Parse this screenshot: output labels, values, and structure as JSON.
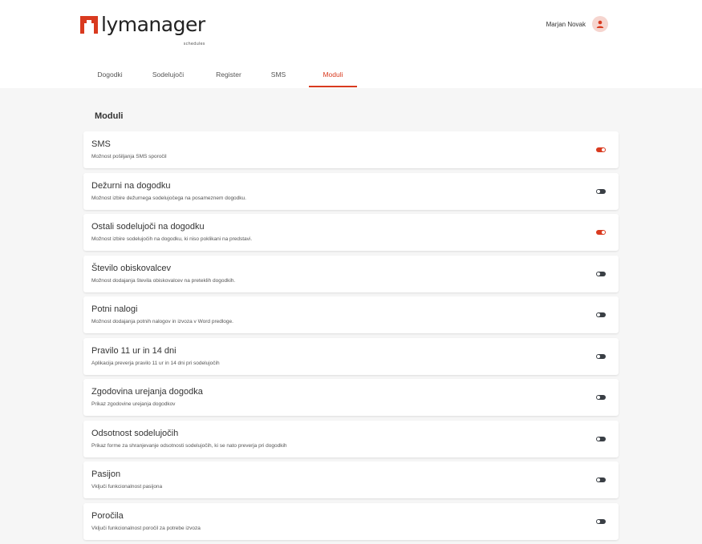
{
  "brand": {
    "name": "lymanager",
    "tagline": "schedules",
    "accent": "#d93a1f"
  },
  "user": {
    "name": "Marjan Novak"
  },
  "tabs": [
    {
      "label": "Dogodki",
      "active": false
    },
    {
      "label": "Sodelujoči",
      "active": false
    },
    {
      "label": "Register",
      "active": false
    },
    {
      "label": "SMS",
      "active": false
    },
    {
      "label": "Moduli",
      "active": true
    }
  ],
  "section": {
    "title": "Moduli"
  },
  "modules": [
    {
      "title": "SMS",
      "description": "Možnost pošiljanja SMS sporočil",
      "enabled": true
    },
    {
      "title": "Dežurni na dogodku",
      "description": "Možnost izbire dežurnega sodelujočega na posameznem dogodku.",
      "enabled": false
    },
    {
      "title": "Ostali sodelujoči na dogodku",
      "description": "Možnost izbire sodelujočih na dogodku, ki niso poklikani na predstavi.",
      "enabled": true
    },
    {
      "title": "Število obiskovalcev",
      "description": "Možnost dodajanja števila obiskovalcev na preteklih dogodkih.",
      "enabled": false
    },
    {
      "title": "Potni nalogi",
      "description": "Možnost dodajanja potnih nalogov in izvoza v Word predloge.",
      "enabled": false
    },
    {
      "title": "Pravilo 11 ur in 14 dni",
      "description": "Aplikacija preverja pravilo 11 ur in 14 dni pri sodelujočih",
      "enabled": false
    },
    {
      "title": "Zgodovina urejanja dogodka",
      "description": "Prikaz zgodovine urejanja dogodkov",
      "enabled": false
    },
    {
      "title": "Odsotnost sodelujočih",
      "description": "Prikaz forme za shranjevanje odsotnosti sodelujočih, ki se nato preverja pri dogodkih",
      "enabled": false
    },
    {
      "title": "Pasijon",
      "description": "Vključi funkcionalnost pasijona",
      "enabled": false
    },
    {
      "title": "Poročila",
      "description": "Vključi funkcionalnost poročil za potrebe izvoza",
      "enabled": false
    }
  ]
}
